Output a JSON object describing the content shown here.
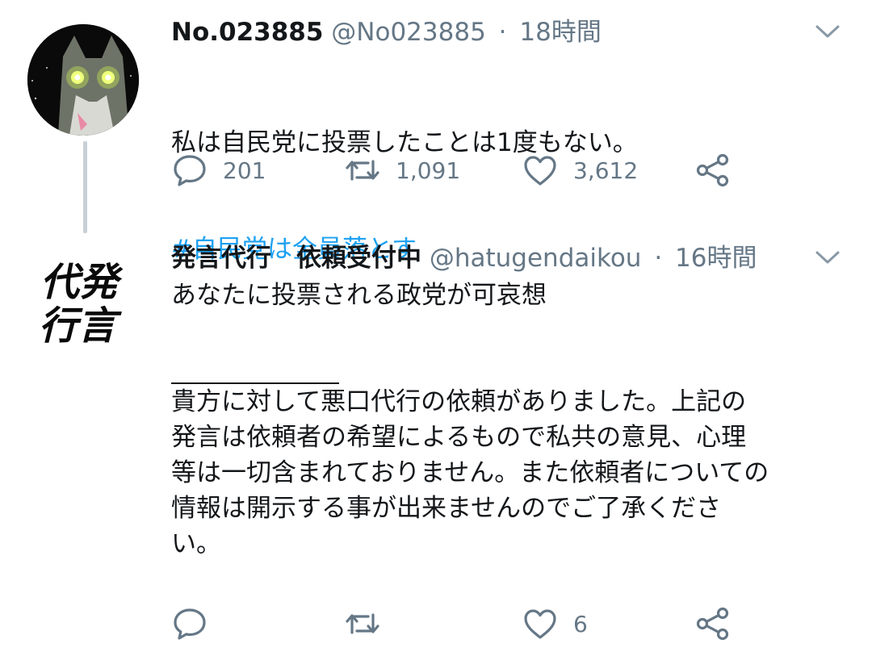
{
  "tweets": [
    {
      "display_name": "No.023885",
      "handle": "@No023885",
      "time": "18時間",
      "text": "私は自民党に投票したことは1度もない。",
      "hashtag": "#自民党は全員落とす",
      "reply_count": "201",
      "retweet_count": "1,091",
      "like_count": "3,612",
      "avatar_icon": "cat-glowing-eyes-avatar"
    },
    {
      "display_name": "発言代行　依頼受付中",
      "handle": "@hatugendaikou",
      "time": "16時間",
      "text": "あなたに投票される政党が可哀想\n\n\n貴方に対して悪口代行の依頼がありました。上記の\n発言は依頼者の希望によるもので私共の意見、心理\n等は一切含まれておりません。また依頼者についての\n情報は開示する事が出来ませんのでご了承くださ\nい。",
      "reply_count": "",
      "retweet_count": "",
      "like_count": "6",
      "avatar_text": "代発\n行言"
    }
  ],
  "separator": "·",
  "colors": {
    "link": "#1da1f2",
    "muted": "#657786",
    "text": "#14171a",
    "thread_line": "#c9d1d8"
  },
  "icons": [
    "reply-icon",
    "retweet-icon",
    "like-icon",
    "share-icon",
    "chevron-down-icon"
  ]
}
